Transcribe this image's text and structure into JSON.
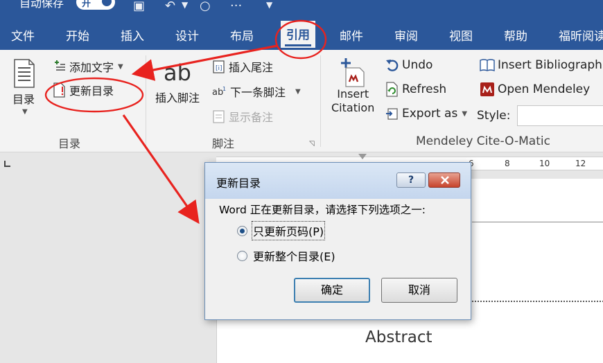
{
  "titlebar": {
    "autosave_text": "自动保存",
    "toggle_text": "开"
  },
  "tabs": [
    {
      "label": "文件"
    },
    {
      "label": "开始"
    },
    {
      "label": "插入"
    },
    {
      "label": "设计"
    },
    {
      "label": "布局"
    },
    {
      "label": "引用"
    },
    {
      "label": "邮件"
    },
    {
      "label": "审阅"
    },
    {
      "label": "视图"
    },
    {
      "label": "帮助"
    },
    {
      "label": "福昕阅读"
    }
  ],
  "ribbon": {
    "toc_group": {
      "toc_button": "目录",
      "add_text": "添加文字",
      "update_toc": "更新目录",
      "label": "目录"
    },
    "footnote_group": {
      "ab_text": "ab",
      "insert_footnote": "插入脚注",
      "insert_endnote": "插入尾注",
      "next_footnote": "下一条脚注",
      "show_notes": "显示备注",
      "label": "脚注"
    },
    "mendeley_group": {
      "insert_citation": [
        "Insert",
        "Citation"
      ],
      "undo": "Undo",
      "refresh": "Refresh",
      "export_as": "Export as",
      "insert_bibliography": "Insert Bibliograph",
      "open_mendeley": "Open Mendeley",
      "style_label": "Style:",
      "style_value": "",
      "label": "Mendeley Cite-O-Matic"
    }
  },
  "ruler": {
    "ticks": [
      "6",
      "8",
      "10",
      "12"
    ]
  },
  "document": {
    "abstract_text": "Abstract"
  },
  "dialog": {
    "title": "更新目录",
    "help_glyph": "?",
    "message": "Word 正在更新目录，请选择下列选项之一:",
    "option_pages": "只更新页码(P)",
    "option_entire": "更新整个目录(E)",
    "selected": "pages",
    "ok_label": "确定",
    "cancel_label": "取消"
  },
  "colors": {
    "word_blue": "#2b579a",
    "annotation_red": "#e8231f",
    "close_red": "#c7432c"
  }
}
